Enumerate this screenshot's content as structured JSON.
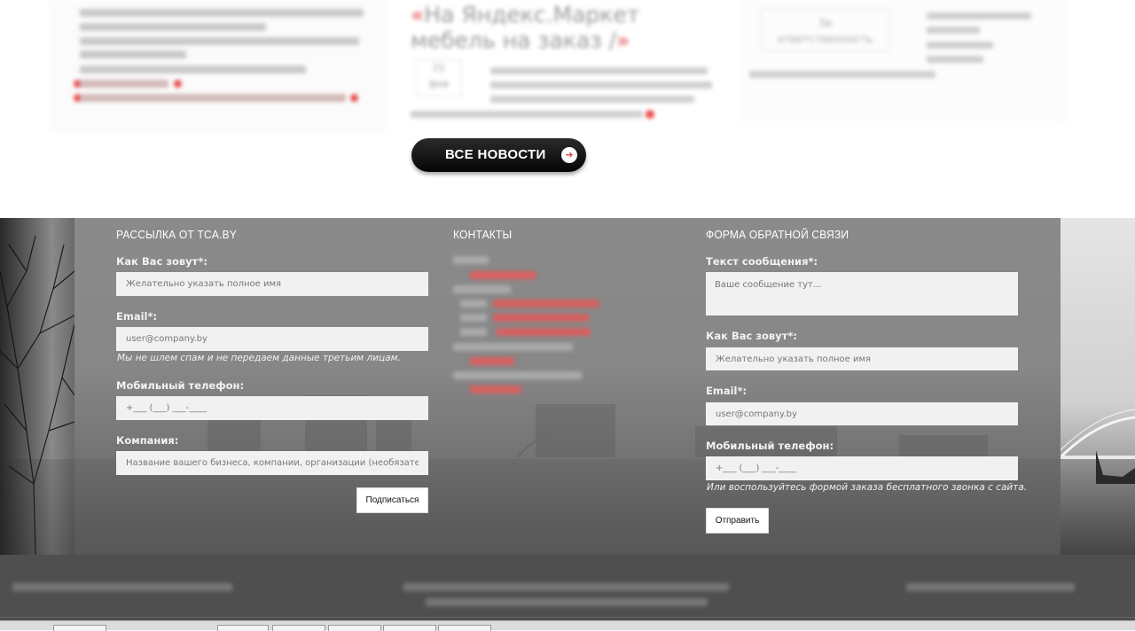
{
  "news": {
    "mid_title_open": "«",
    "mid_title": "На Яндекс.Маркет мебель на заказ /",
    "mid_title_close": "»",
    "mid_date_day": "21",
    "mid_date_month": "фев",
    "right_box_line1": "За",
    "right_box_line2": "ответственность",
    "all_news_label": "ВСЕ НОВОСТИ",
    "arrow_glyph": "➜"
  },
  "subscribe": {
    "heading": "РАССЫЛКА ОТ TCA.BY",
    "name_label": "Как Вас зовут*:",
    "name_placeholder": "Желательно указать полное имя",
    "email_label": "Email*:",
    "email_placeholder": "user@company.by",
    "spam_note": "Мы не шлем спам и не передаем данные третьим лицам.",
    "phone_label": "Мобильный телефон:",
    "phone_placeholder": "+___ (___) ___-____",
    "company_label": "Компания:",
    "company_placeholder": "Название вашего бизнеса, компании, организации (необязательно)",
    "submit_label": "Подписаться"
  },
  "contacts": {
    "heading": "КОНТАКТЫ"
  },
  "feedback": {
    "heading": "ФОРМА ОБРАТНОЙ СВЯЗИ",
    "message_label": "Текст сообщения*:",
    "message_placeholder": "Ваше сообщение тут...",
    "name_label": "Как Вас зовут*:",
    "name_placeholder": "Желательно указать полное имя",
    "email_label": "Email*:",
    "email_placeholder": "user@company.by",
    "phone_label": "Мобильный телефон:",
    "phone_placeholder": "+___ (___) ___-____",
    "call_note": "Или воспользуйтесь формой заказа бесплатного звонка с сайта.",
    "submit_label": "Отправить"
  }
}
